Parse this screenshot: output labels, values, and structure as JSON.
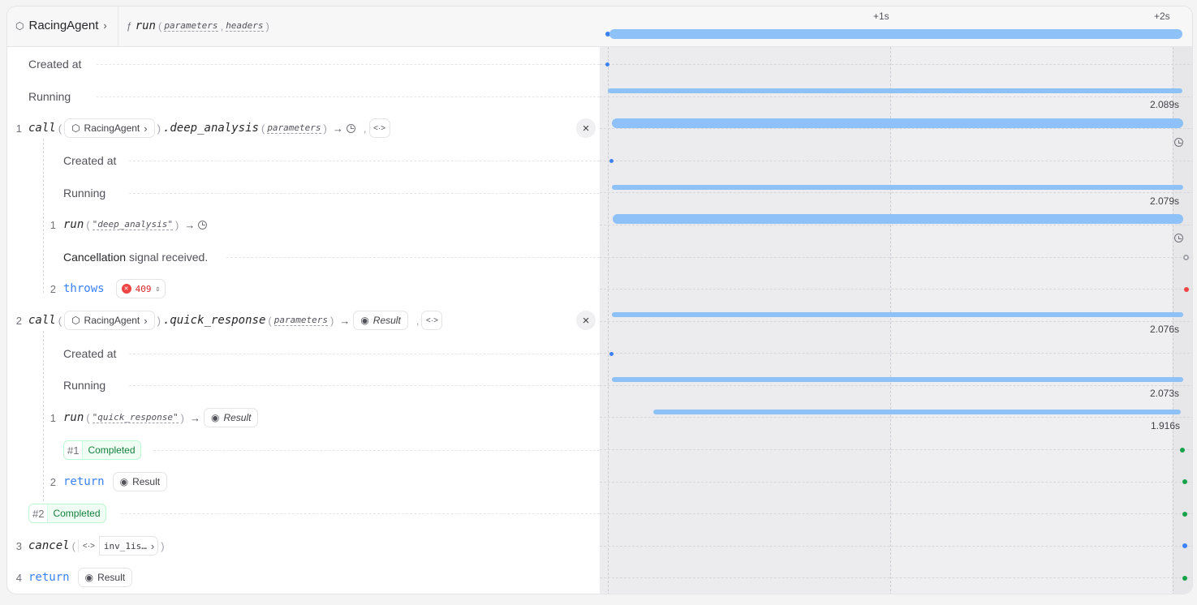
{
  "header": {
    "service": "RacingAgent",
    "fn_icon": "ƒ",
    "handler": "run",
    "params": [
      "parameters",
      "headers"
    ]
  },
  "timeline": {
    "ticks": [
      "+1s",
      "+2s"
    ]
  },
  "rows": {
    "created_at": "Created at",
    "running": "Running",
    "call1": {
      "num": "1",
      "kw": "call",
      "service": "RacingAgent",
      "method": ".deep_analysis",
      "param": "parameters",
      "duration": "2.089s"
    },
    "c1_created": "Created at",
    "c1_running": "Running",
    "c1_running_duration": "2.079s",
    "c1_run": {
      "num": "1",
      "kw": "run",
      "arg": "\"deep_analysis\""
    },
    "c1_cancel": {
      "bold": "Cancellation",
      "rest": " signal received."
    },
    "c1_throws": {
      "num": "2",
      "kw": "throws",
      "code": "409"
    },
    "call2": {
      "num": "2",
      "kw": "call",
      "service": "RacingAgent",
      "method": ".quick_response",
      "param": "parameters",
      "result": "Result",
      "duration": "2.076s"
    },
    "c2_created": "Created at",
    "c2_running": "Running",
    "c2_running_duration": "2.073s",
    "c2_run": {
      "num": "1",
      "kw": "run",
      "arg": "\"quick_response\"",
      "result": "Result",
      "duration": "1.916s"
    },
    "c2_completed": {
      "n": "#1",
      "t": "Completed"
    },
    "c2_return": {
      "num": "2",
      "kw": "return",
      "result": "Result"
    },
    "completed2": {
      "n": "#2",
      "t": "Completed"
    },
    "cancel": {
      "num": "3",
      "kw": "cancel",
      "target": "inv_1is…"
    },
    "ret": {
      "num": "4",
      "kw": "return",
      "result": "Result"
    }
  },
  "colors": {
    "bar": "#8ec1f7",
    "blue_dot": "#3b82f6",
    "green_dot": "#16a34a",
    "red_dot": "#ef4444",
    "gray_dot": "#a1a1aa"
  }
}
